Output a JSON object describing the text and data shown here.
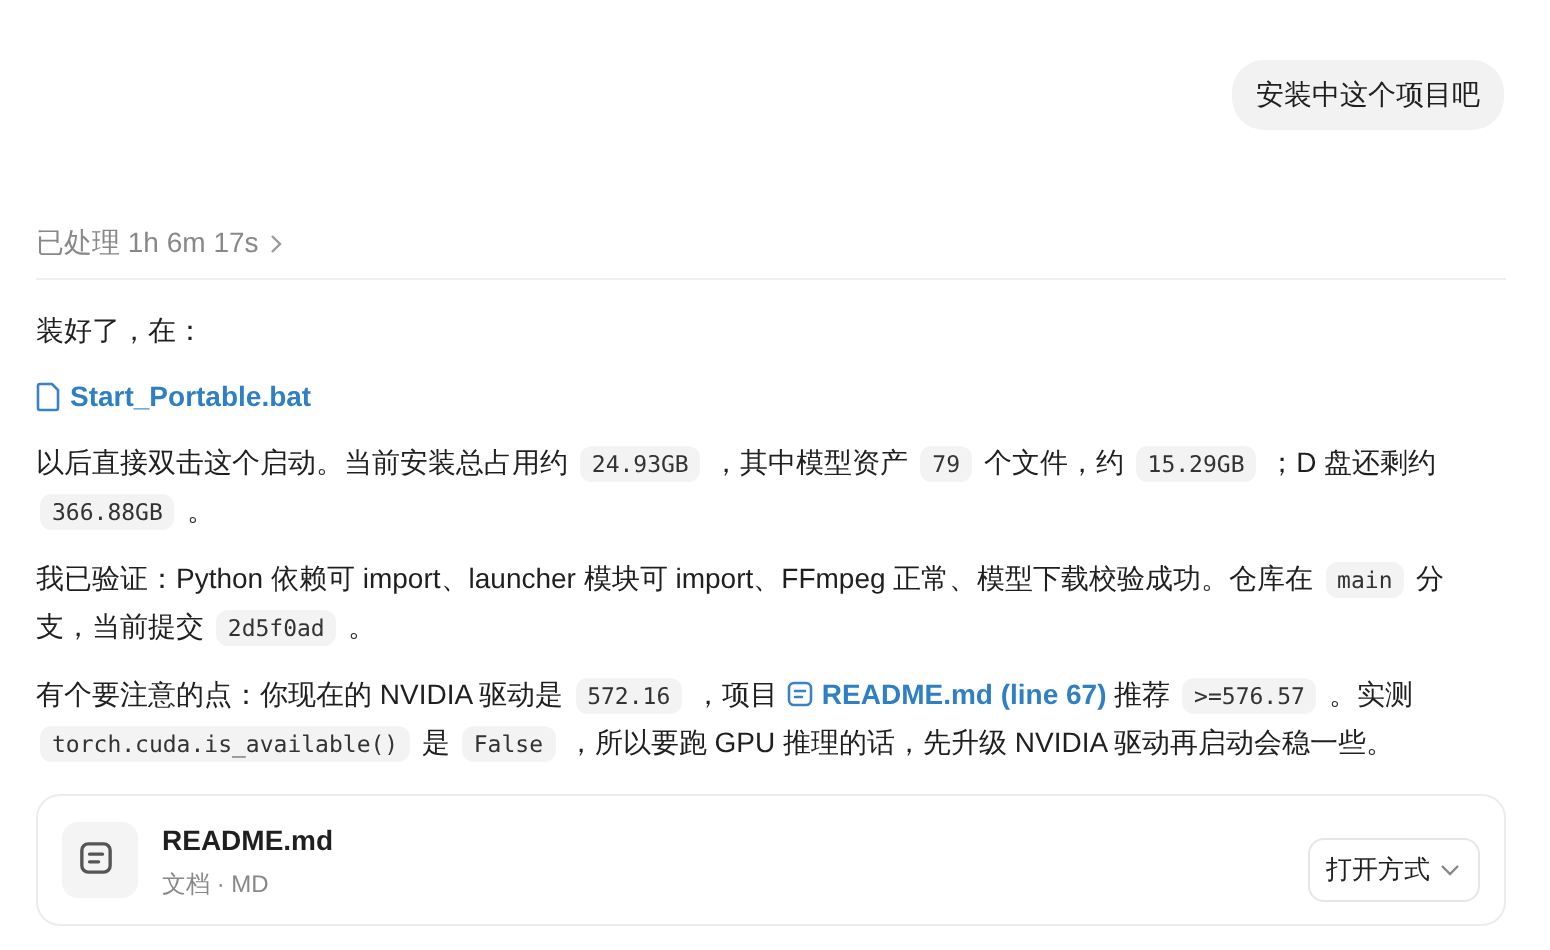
{
  "user_message": "安装中这个项目吧",
  "processed": {
    "label": "已处理",
    "duration": "1h 6m 17s"
  },
  "paragraphs": [
    [
      {
        "kind": "text",
        "text": "装好了，在："
      }
    ],
    [
      {
        "kind": "file_link",
        "text": "Start_Portable.bat"
      }
    ],
    [
      {
        "kind": "text",
        "text": "以后直接双击这个启动。当前安装总占用约 "
      },
      {
        "kind": "code",
        "text": "24.93GB"
      },
      {
        "kind": "text",
        "text": " ，其中模型资产 "
      },
      {
        "kind": "code",
        "text": "79"
      },
      {
        "kind": "text",
        "text": " 个文件，约 "
      },
      {
        "kind": "code",
        "text": "15.29GB"
      },
      {
        "kind": "text",
        "text": " ；D 盘还剩约 "
      },
      {
        "kind": "code",
        "text": "366.88GB"
      },
      {
        "kind": "text",
        "text": " 。"
      }
    ],
    [
      {
        "kind": "text",
        "text": "我已验证：Python 依赖可 import、launcher 模块可 import、FFmpeg 正常、模型下载校验成功。仓库在 "
      },
      {
        "kind": "code",
        "text": "main"
      },
      {
        "kind": "text",
        "text": " 分支，当前提交 "
      },
      {
        "kind": "code",
        "text": "2d5f0ad"
      },
      {
        "kind": "text",
        "text": " 。"
      }
    ],
    [
      {
        "kind": "text",
        "text": "有个要注意的点：你现在的 NVIDIA 驱动是 "
      },
      {
        "kind": "code",
        "text": "572.16"
      },
      {
        "kind": "text",
        "text": " ，项目 "
      },
      {
        "kind": "doc_link",
        "text": "README.md (line 67)"
      },
      {
        "kind": "text",
        "text": " 推荐 "
      },
      {
        "kind": "code",
        "text": ">=576.57"
      },
      {
        "kind": "text",
        "text": " 。实测 "
      },
      {
        "kind": "code",
        "text": "torch.cuda.is_available()"
      },
      {
        "kind": "text",
        "text": " 是 "
      },
      {
        "kind": "code",
        "text": "False"
      },
      {
        "kind": "text",
        "text": " ，所以要跑 GPU 推理的话，先升级 NVIDIA 驱动再启动会稳一些。"
      }
    ]
  ],
  "file_card": {
    "name": "README.md",
    "meta": "文档 · MD",
    "open_with": "打开方式"
  }
}
